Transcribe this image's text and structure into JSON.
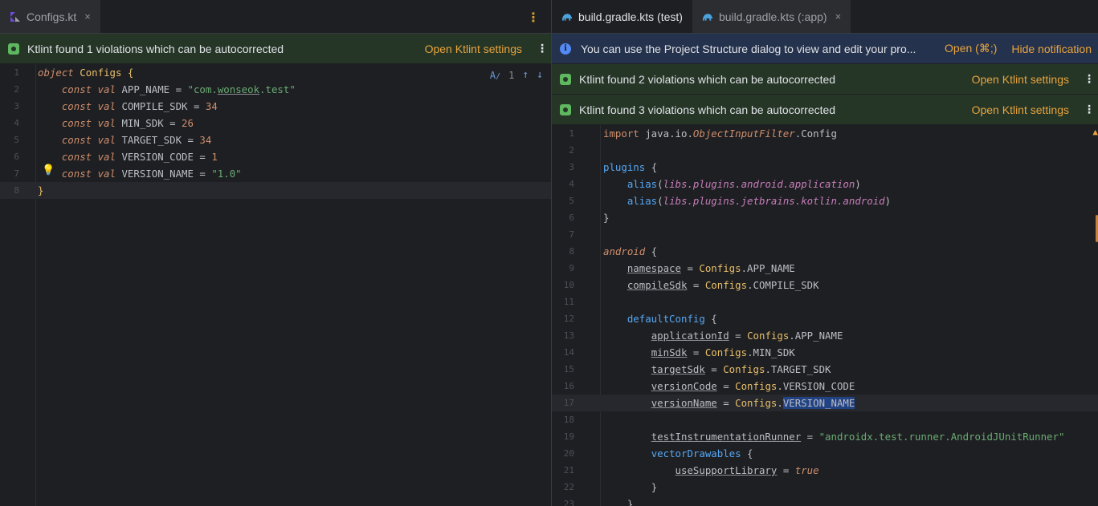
{
  "left": {
    "tab": {
      "label": "Configs.kt",
      "close": "×"
    },
    "more": "⋮",
    "banner": {
      "text": "Ktlint found 1 violations which can be autocorrected",
      "link": "Open Ktlint settings",
      "menu": "⋮"
    },
    "inspect": {
      "count": "1",
      "up": "↑",
      "down": "↓"
    },
    "lines": [
      {
        "n": "1",
        "segs": [
          [
            "kw",
            "object"
          ],
          [
            "t",
            " "
          ],
          [
            "cls",
            "Configs"
          ],
          [
            "t",
            " "
          ],
          [
            "brace",
            "{"
          ]
        ]
      },
      {
        "n": "2",
        "segs": [
          [
            "t",
            "    "
          ],
          [
            "kw",
            "const val"
          ],
          [
            "t",
            " APP_NAME = "
          ],
          [
            "str",
            "\"com."
          ],
          [
            "str und",
            "wonseok"
          ],
          [
            "str",
            ".test\""
          ]
        ]
      },
      {
        "n": "3",
        "segs": [
          [
            "t",
            "    "
          ],
          [
            "kw",
            "const val"
          ],
          [
            "t",
            " COMPILE_SDK = "
          ],
          [
            "kwp",
            "34"
          ]
        ]
      },
      {
        "n": "4",
        "segs": [
          [
            "t",
            "    "
          ],
          [
            "kw",
            "const val"
          ],
          [
            "t",
            " MIN_SDK = "
          ],
          [
            "kwp",
            "26"
          ]
        ]
      },
      {
        "n": "5",
        "segs": [
          [
            "t",
            "    "
          ],
          [
            "kw",
            "const val"
          ],
          [
            "t",
            " TARGET_SDK = "
          ],
          [
            "kwp",
            "34"
          ]
        ]
      },
      {
        "n": "6",
        "segs": [
          [
            "t",
            "    "
          ],
          [
            "kw",
            "const val"
          ],
          [
            "t",
            " VERSION_CODE = "
          ],
          [
            "kwp",
            "1"
          ]
        ]
      },
      {
        "n": "7",
        "segs": [
          [
            "t",
            "    "
          ],
          [
            "kw",
            "const val"
          ],
          [
            "t",
            " VERSION_NAME = "
          ],
          [
            "str",
            "\"1.0\""
          ]
        ]
      },
      {
        "n": "8",
        "segs": [
          [
            "brace",
            "}"
          ]
        ]
      }
    ]
  },
  "right": {
    "tabs": [
      {
        "label": "build.gradle.kts (test)"
      },
      {
        "label": "build.gradle.kts (:app)",
        "close": "×"
      }
    ],
    "more": "⋮",
    "info_banner": {
      "text": "You can use the Project Structure dialog to view and edit your pro...",
      "open": "Open (⌘;)",
      "hide": "Hide notification"
    },
    "banners": [
      {
        "text": "Ktlint found 2 violations which can be autocorrected",
        "link": "Open Ktlint settings",
        "menu": "⋮"
      },
      {
        "text": "Ktlint found 3 violations which can be autocorrected",
        "link": "Open Ktlint settings",
        "menu": "⋮"
      }
    ],
    "lines": [
      {
        "n": "1",
        "segs": [
          [
            "kwp",
            "import"
          ],
          [
            "t",
            " java.io."
          ],
          [
            "kw",
            "ObjectInputFilter"
          ],
          [
            "t",
            ".Config"
          ]
        ]
      },
      {
        "n": "2",
        "segs": []
      },
      {
        "n": "3",
        "segs": [
          [
            "fn",
            "plugins"
          ],
          [
            "t",
            " "
          ],
          [
            "t",
            "{"
          ]
        ]
      },
      {
        "n": "4",
        "segs": [
          [
            "t",
            "    "
          ],
          [
            "fn",
            "alias"
          ],
          [
            "t",
            "("
          ],
          [
            "plug",
            "libs.plugins.android.application"
          ],
          [
            "t",
            ")"
          ]
        ]
      },
      {
        "n": "5",
        "segs": [
          [
            "t",
            "    "
          ],
          [
            "fn",
            "alias"
          ],
          [
            "t",
            "("
          ],
          [
            "plug",
            "libs.plugins.jetbrains.kotlin.android"
          ],
          [
            "t",
            ")"
          ]
        ]
      },
      {
        "n": "6",
        "segs": [
          [
            "t",
            "}"
          ]
        ]
      },
      {
        "n": "7",
        "segs": []
      },
      {
        "n": "8",
        "segs": [
          [
            "kw",
            "android"
          ],
          [
            "t",
            " {"
          ]
        ]
      },
      {
        "n": "9",
        "segs": [
          [
            "t",
            "    "
          ],
          [
            "und",
            "namespace"
          ],
          [
            "t",
            " = "
          ],
          [
            "cls",
            "Configs"
          ],
          [
            "t",
            ".APP_NAME"
          ]
        ]
      },
      {
        "n": "10",
        "segs": [
          [
            "t",
            "    "
          ],
          [
            "und",
            "compileSdk"
          ],
          [
            "t",
            " = "
          ],
          [
            "cls",
            "Configs"
          ],
          [
            "t",
            ".COMPILE_SDK"
          ]
        ]
      },
      {
        "n": "11",
        "segs": []
      },
      {
        "n": "12",
        "segs": [
          [
            "t",
            "    "
          ],
          [
            "fn",
            "defaultConfig"
          ],
          [
            "t",
            " {"
          ]
        ]
      },
      {
        "n": "13",
        "segs": [
          [
            "t",
            "        "
          ],
          [
            "und",
            "applicationId"
          ],
          [
            "t",
            " = "
          ],
          [
            "cls",
            "Configs"
          ],
          [
            "t",
            ".APP_NAME"
          ]
        ]
      },
      {
        "n": "14",
        "segs": [
          [
            "t",
            "        "
          ],
          [
            "und",
            "minSdk"
          ],
          [
            "t",
            " = "
          ],
          [
            "cls",
            "Configs"
          ],
          [
            "t",
            ".MIN_SDK"
          ]
        ]
      },
      {
        "n": "15",
        "segs": [
          [
            "t",
            "        "
          ],
          [
            "und",
            "targetSdk"
          ],
          [
            "t",
            " = "
          ],
          [
            "cls",
            "Configs"
          ],
          [
            "t",
            ".TARGET_SDK"
          ]
        ]
      },
      {
        "n": "16",
        "segs": [
          [
            "t",
            "        "
          ],
          [
            "und",
            "versionCode"
          ],
          [
            "t",
            " = "
          ],
          [
            "cls",
            "Configs"
          ],
          [
            "t",
            ".VERSION_CODE"
          ]
        ]
      },
      {
        "n": "17",
        "segs": [
          [
            "t",
            "        "
          ],
          [
            "und",
            "versionName"
          ],
          [
            "t",
            " = "
          ],
          [
            "cls",
            "Configs"
          ],
          [
            "t",
            "."
          ],
          [
            "sel",
            "VERSION_NAME"
          ]
        ]
      },
      {
        "n": "18",
        "segs": []
      },
      {
        "n": "19",
        "segs": [
          [
            "t",
            "        "
          ],
          [
            "und",
            "testInstrumentationRunner"
          ],
          [
            "t",
            " = "
          ],
          [
            "str",
            "\"androidx.test.runner.AndroidJUnitRunner\""
          ]
        ]
      },
      {
        "n": "20",
        "segs": [
          [
            "t",
            "        "
          ],
          [
            "fn",
            "vectorDrawables"
          ],
          [
            "t",
            " {"
          ]
        ]
      },
      {
        "n": "21",
        "segs": [
          [
            "t",
            "            "
          ],
          [
            "und",
            "useSupportLibrary"
          ],
          [
            "t",
            " = "
          ],
          [
            "kw",
            "true"
          ]
        ]
      },
      {
        "n": "22",
        "segs": [
          [
            "t",
            "        "
          ],
          [
            "t",
            "}"
          ]
        ]
      },
      {
        "n": "23",
        "segs": [
          [
            "t",
            "    "
          ],
          [
            "t",
            "}"
          ]
        ]
      }
    ]
  }
}
